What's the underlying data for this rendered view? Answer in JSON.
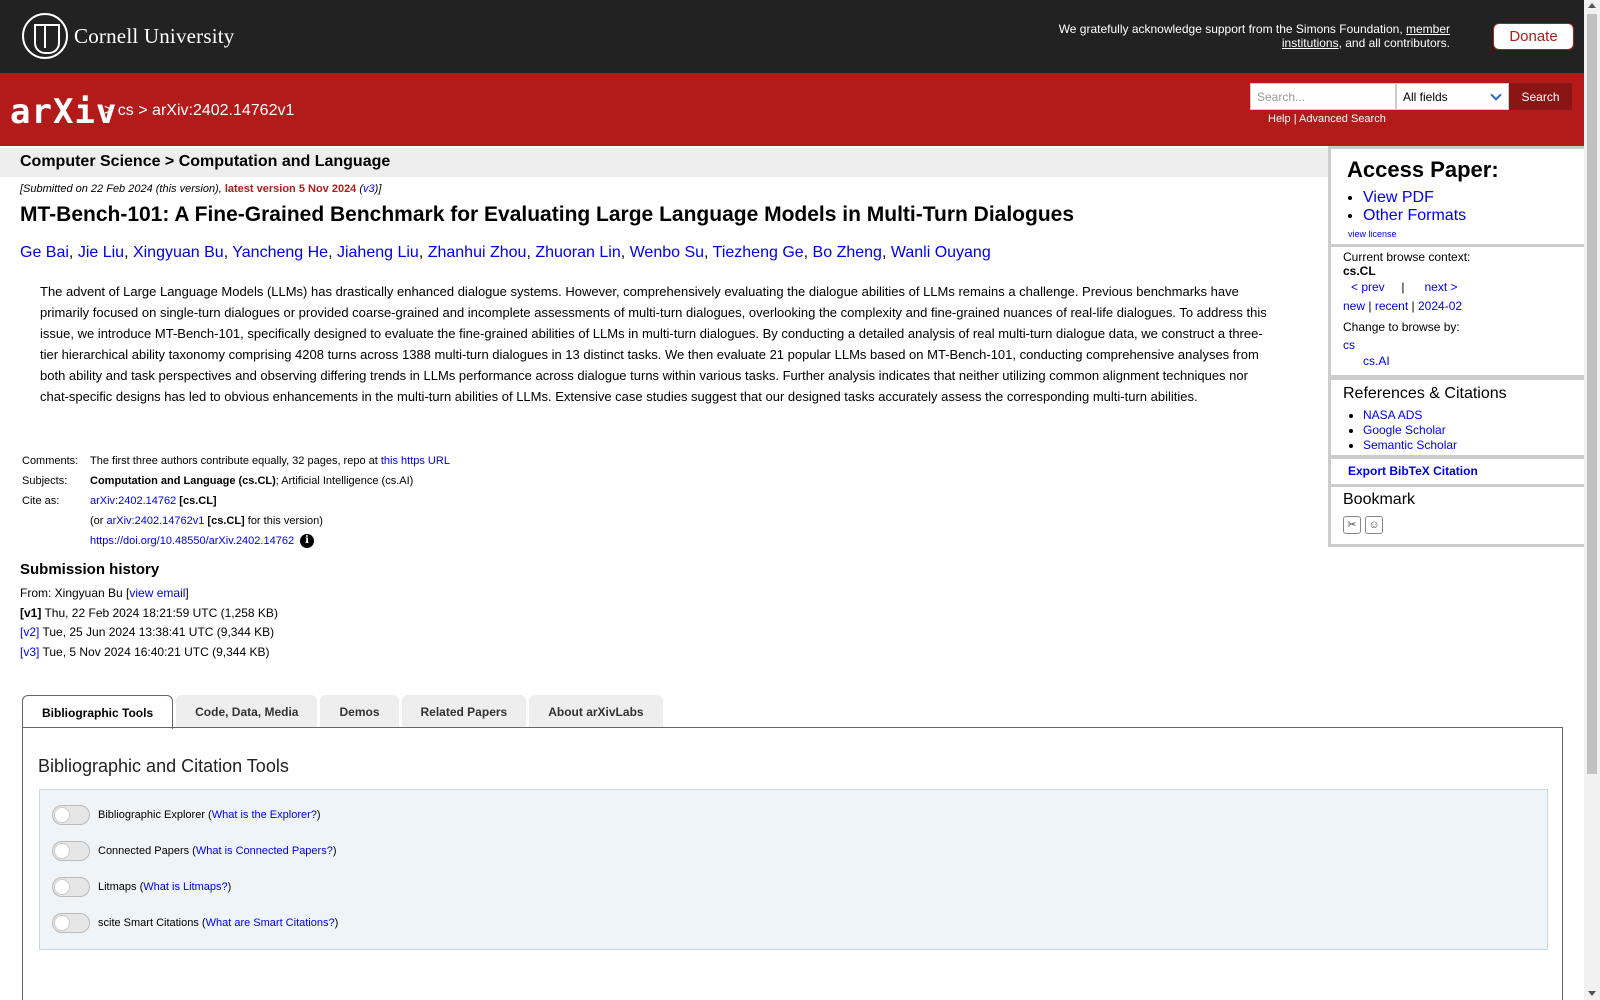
{
  "topbar": {
    "university": "Cornell University",
    "support_prefix": "We gratefully acknowledge support from the Simons Foundation, ",
    "support_link": "member institutions",
    "support_suffix": ", and all contributors.",
    "donate": "Donate"
  },
  "header": {
    "logo": "arXiv",
    "crumb_sep1": ">",
    "crumb_cs": "cs",
    "crumb_sep2": ">",
    "crumb_id": "arXiv:2402.14762v1",
    "search_placeholder": "Search...",
    "search_field": "All fields",
    "search_button": "Search",
    "help": "Help",
    "link_sep": "|",
    "advanced": "Advanced Search"
  },
  "subheader": "Computer Science > Computation and Language",
  "paper": {
    "submitted_prefix": "[Submitted on 22 Feb 2024 (this version), ",
    "latest": "latest version 5 Nov 2024",
    "version_open": " (",
    "version_link": "v3",
    "version_close": ")]",
    "title": "MT-Bench-101: A Fine-Grained Benchmark for Evaluating Large Language Models in Multi-Turn Dialogues",
    "authors": [
      "Ge Bai",
      "Jie Liu",
      "Xingyuan Bu",
      "Yancheng He",
      "Jiaheng Liu",
      "Zhanhui Zhou",
      "Zhuoran Lin",
      "Wenbo Su",
      "Tiezheng Ge",
      "Bo Zheng",
      "Wanli Ouyang"
    ],
    "abstract": "The advent of Large Language Models (LLMs) has drastically enhanced dialogue systems. However, comprehensively evaluating the dialogue abilities of LLMs remains a challenge. Previous benchmarks have primarily focused on single-turn dialogues or provided coarse-grained and incomplete assessments of multi-turn dialogues, overlooking the complexity and fine-grained nuances of real-life dialogues. To address this issue, we introduce MT-Bench-101, specifically designed to evaluate the fine-grained abilities of LLMs in multi-turn dialogues. By conducting a detailed analysis of real multi-turn dialogue data, we construct a three-tier hierarchical ability taxonomy comprising 4208 turns across 1388 multi-turn dialogues in 13 distinct tasks. We then evaluate 21 popular LLMs based on MT-Bench-101, conducting comprehensive analyses from both ability and task perspectives and observing differing trends in LLMs performance across dialogue turns within various tasks. Further analysis indicates that neither utilizing common alignment techniques nor chat-specific designs has led to obvious enhancements in the multi-turn abilities of LLMs. Extensive case studies suggest that our designed tasks accurately assess the corresponding multi-turn abilities."
  },
  "meta": {
    "comments_label": "Comments:",
    "comments_text": "The first three authors contribute equally, 32 pages, repo at ",
    "comments_link": "this https URL",
    "subjects_label": "Subjects:",
    "subjects_primary": "Computation and Language (cs.CL)",
    "subjects_rest": "; Artificial Intelligence (cs.AI)",
    "cite_label": "Cite as:",
    "cite_id": "arXiv:2402.14762",
    "cite_cat": " [cs.CL]",
    "cite_v_open": "(or ",
    "cite_v_id": "arXiv:2402.14762v1",
    "cite_v_cat": " [cs.CL]",
    "cite_v_close": " for this version)",
    "doi": "https://doi.org/10.48550/arXiv.2402.14762",
    "info_icon": "i"
  },
  "history": {
    "heading": "Submission history",
    "from_prefix": "From: Xingyuan Bu [",
    "view_email": "view email",
    "from_suffix": "]",
    "versions": [
      {
        "label": "[v1]",
        "text": " Thu, 22 Feb 2024 18:21:59 UTC (1,258 KB)"
      },
      {
        "label": "[v2]",
        "text": " Tue, 25 Jun 2024 13:38:41 UTC (9,344 KB)"
      },
      {
        "label": "[v3]",
        "text": " Tue, 5 Nov 2024 16:40:21 UTC (9,344 KB)"
      }
    ]
  },
  "sidebar": {
    "access_heading": "Access Paper:",
    "view_pdf": "View PDF",
    "other_formats": "Other Formats",
    "view_license": "view license",
    "context_label": "Current browse context:",
    "context_value": "cs.CL",
    "prev": "< prev",
    "sep": "|",
    "next": "next >",
    "new": "new",
    "recent": "recent",
    "month": "2024-02",
    "change_label": "Change to browse by:",
    "browse_cs": "cs",
    "browse_csai": "cs.AI",
    "refs_heading": "References & Citations",
    "nasa": "NASA ADS",
    "scholar": "Google Scholar",
    "semantic": "Semantic Scholar",
    "bibtex": "Export BibTeX Citation",
    "bookmark_heading": "Bookmark"
  },
  "tabs": [
    "Bibliographic Tools",
    "Code, Data, Media",
    "Demos",
    "Related Papers",
    "About arXivLabs"
  ],
  "panel": {
    "title": "Bibliographic and Citation Tools",
    "tools": [
      {
        "name": "Bibliographic Explorer",
        "link": "What is the Explorer?"
      },
      {
        "name": "Connected Papers",
        "link": "What is Connected Papers?"
      },
      {
        "name": "Litmaps",
        "link": "What is Litmaps?"
      },
      {
        "name": "scite Smart Citations",
        "link": "What are Smart Citations?"
      }
    ]
  }
}
